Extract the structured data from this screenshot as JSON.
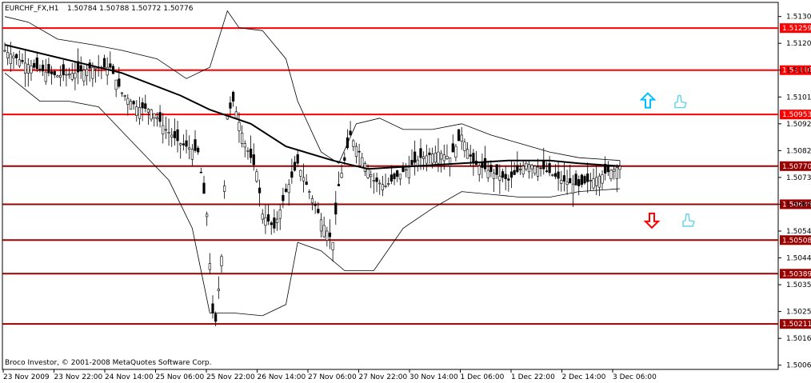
{
  "header": {
    "symbol": "EURCHF_FX,H1",
    "ohlc": "1.50784 1.50788 1.50772 1.50776"
  },
  "footer": {
    "copyright": "Broco Investor, © 2001-2008 MetaQuotes Software Corp."
  },
  "colors": {
    "level_line": "#ff0000",
    "level_line_dark": "#990000",
    "label_bg": "#ff0000",
    "label_bg_dark": "#990000",
    "arrow_up": "#00bfff",
    "arrow_down": "#ff0000",
    "thumb": "#5fd3e8",
    "ma": "#000000"
  },
  "icons": {
    "up_arrow": "up-arrow-icon",
    "down_arrow": "down-arrow-icon",
    "thumb": "thumbs-up-icon"
  },
  "chart_data": {
    "type": "candlestick",
    "ylim": [
      1.5005,
      1.5135
    ],
    "y_ticks": [
      "1.51300",
      "1.51205",
      "1.51110",
      "1.51015",
      "1.50920",
      "1.50825",
      "1.50730",
      "1.50635",
      "1.50540",
      "1.50445",
      "1.50350",
      "1.50255",
      "1.50160",
      "1.50065"
    ],
    "y_tick_values": [
      1.513,
      1.51205,
      1.5111,
      1.51015,
      1.5092,
      1.50825,
      1.5073,
      1.50635,
      1.5054,
      1.50445,
      1.5035,
      1.50255,
      1.5016,
      1.50065
    ],
    "x_labels": [
      "23 Nov 2009",
      "23 Nov 22:00",
      "24 Nov 14:00",
      "25 Nov 06:00",
      "25 Nov 22:00",
      "26 Nov 14:00",
      "27 Nov 06:00",
      "27 Nov 22:00",
      "30 Nov 14:00",
      "1 Dec 06:00",
      "1 Dec 22:00",
      "2 Dec 14:00",
      "3 Dec 06:00"
    ],
    "bars_count": 242,
    "levels": [
      {
        "label": "1.51259",
        "value": 1.51259,
        "dark": false
      },
      {
        "label": "1.51110",
        "value": 1.5111,
        "dark": false
      },
      {
        "label": "1.50953",
        "value": 1.50953,
        "dark": false
      },
      {
        "label": "1.50770",
        "value": 1.5077,
        "dark": true
      },
      {
        "label": "1.50635",
        "value": 1.50635,
        "dark": true
      },
      {
        "label": "1.50508",
        "value": 1.50508,
        "dark": true
      },
      {
        "label": "1.50389",
        "value": 1.50389,
        "dark": true
      },
      {
        "label": "1.50211",
        "value": 1.50211,
        "dark": true
      }
    ],
    "close_path": [
      [
        0,
        1.5118
      ],
      [
        6,
        1.5114
      ],
      [
        12,
        1.5111
      ],
      [
        18,
        1.5109
      ],
      [
        24,
        1.511
      ],
      [
        30,
        1.5112
      ],
      [
        36,
        1.5112
      ],
      [
        40,
        1.5103
      ],
      [
        45,
        1.5098
      ],
      [
        50,
        1.5097
      ],
      [
        55,
        1.509
      ],
      [
        60,
        1.5085
      ],
      [
        66,
        1.5082
      ],
      [
        69,
        1.506
      ],
      [
        71,
        1.5025
      ],
      [
        72,
        1.5022
      ],
      [
        74,
        1.5045
      ],
      [
        76,
        1.5095
      ],
      [
        78,
        1.51
      ],
      [
        82,
        1.5085
      ],
      [
        86,
        1.5075
      ],
      [
        88,
        1.506
      ],
      [
        92,
        1.5055
      ],
      [
        96,
        1.5068
      ],
      [
        100,
        1.5078
      ],
      [
        104,
        1.5068
      ],
      [
        108,
        1.5058
      ],
      [
        112,
        1.505
      ],
      [
        114,
        1.507
      ],
      [
        118,
        1.5088
      ],
      [
        122,
        1.508
      ],
      [
        126,
        1.5072
      ],
      [
        130,
        1.507
      ],
      [
        136,
        1.5075
      ],
      [
        142,
        1.508
      ],
      [
        148,
        1.5082
      ],
      [
        152,
        1.508
      ],
      [
        156,
        1.5088
      ],
      [
        160,
        1.5078
      ],
      [
        166,
        1.5075
      ],
      [
        172,
        1.5072
      ],
      [
        178,
        1.5078
      ],
      [
        184,
        1.5076
      ],
      [
        190,
        1.5072
      ],
      [
        196,
        1.507
      ],
      [
        202,
        1.5073
      ],
      [
        206,
        1.5075
      ],
      [
        210,
        1.5077
      ]
    ],
    "ma_path": [
      [
        0,
        1.512
      ],
      [
        20,
        1.5115
      ],
      [
        40,
        1.511
      ],
      [
        60,
        1.5102
      ],
      [
        70,
        1.5097
      ],
      [
        84,
        1.5092
      ],
      [
        96,
        1.5084
      ],
      [
        112,
        1.5079
      ],
      [
        124,
        1.5076
      ],
      [
        140,
        1.5077
      ],
      [
        156,
        1.5078
      ],
      [
        172,
        1.5079
      ],
      [
        186,
        1.5079
      ],
      [
        196,
        1.5078
      ],
      [
        210,
        1.5077
      ]
    ],
    "bb_upper": [
      [
        0,
        1.513
      ],
      [
        8,
        1.5128
      ],
      [
        18,
        1.5122
      ],
      [
        30,
        1.512
      ],
      [
        40,
        1.5118
      ],
      [
        52,
        1.5115
      ],
      [
        62,
        1.5108
      ],
      [
        70,
        1.5112
      ],
      [
        76,
        1.5132
      ],
      [
        80,
        1.5126
      ],
      [
        88,
        1.5125
      ],
      [
        96,
        1.5115
      ],
      [
        100,
        1.51
      ],
      [
        108,
        1.5082
      ],
      [
        114,
        1.5078
      ],
      [
        120,
        1.5092
      ],
      [
        128,
        1.5094
      ],
      [
        136,
        1.509
      ],
      [
        146,
        1.509
      ],
      [
        156,
        1.5092
      ],
      [
        166,
        1.5088
      ],
      [
        176,
        1.5085
      ],
      [
        186,
        1.5082
      ],
      [
        196,
        1.508
      ],
      [
        210,
        1.5079
      ]
    ],
    "bb_lower": [
      [
        0,
        1.511
      ],
      [
        12,
        1.51
      ],
      [
        22,
        1.51
      ],
      [
        32,
        1.5098
      ],
      [
        44,
        1.5085
      ],
      [
        56,
        1.5072
      ],
      [
        64,
        1.5055
      ],
      [
        70,
        1.5025
      ],
      [
        78,
        1.5025
      ],
      [
        88,
        1.5024
      ],
      [
        96,
        1.5028
      ],
      [
        100,
        1.505
      ],
      [
        108,
        1.5047
      ],
      [
        116,
        1.504
      ],
      [
        126,
        1.504
      ],
      [
        136,
        1.5055
      ],
      [
        146,
        1.5062
      ],
      [
        156,
        1.5068
      ],
      [
        166,
        1.5067
      ],
      [
        176,
        1.5066
      ],
      [
        186,
        1.5066
      ],
      [
        196,
        1.5068
      ],
      [
        210,
        1.5069
      ]
    ],
    "annotations": [
      {
        "type": "up-arrow",
        "x": 810,
        "price": 1.51
      },
      {
        "type": "thumb",
        "x": 850,
        "price": 1.51
      },
      {
        "type": "down-arrow",
        "x": 815,
        "price": 1.5058
      },
      {
        "type": "thumb",
        "x": 860,
        "price": 1.5058
      }
    ]
  }
}
